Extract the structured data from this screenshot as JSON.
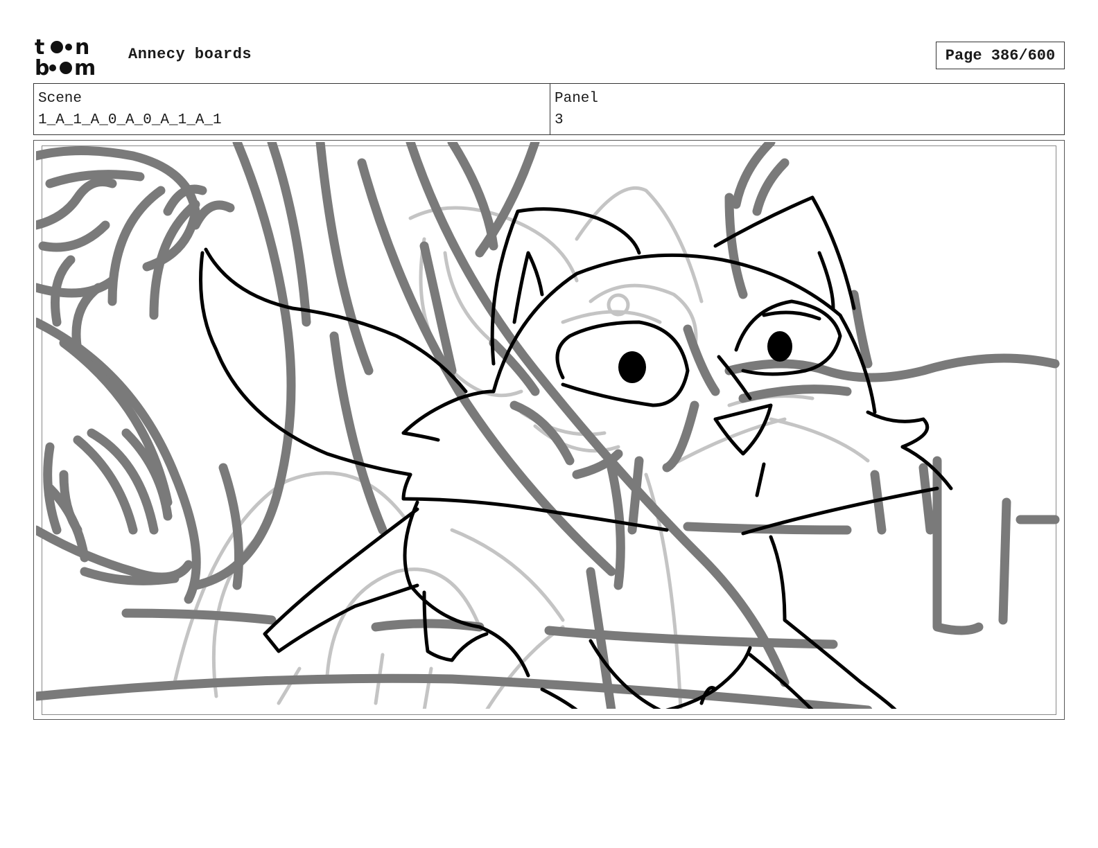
{
  "header": {
    "logo_text": "toon boom",
    "title": "Annecy boards",
    "page_label": "Page 386/600"
  },
  "info": {
    "scene_label": "Scene",
    "scene_value": "1_A_1_A_0_A_0_A_1_A_1",
    "panel_label": "Panel",
    "panel_value": "3"
  },
  "colors": {
    "ink": "#000000",
    "rough": "#777777",
    "light": "#bdbdbd"
  },
  "icons": {
    "logo": "toon-boom-logo-icon"
  }
}
